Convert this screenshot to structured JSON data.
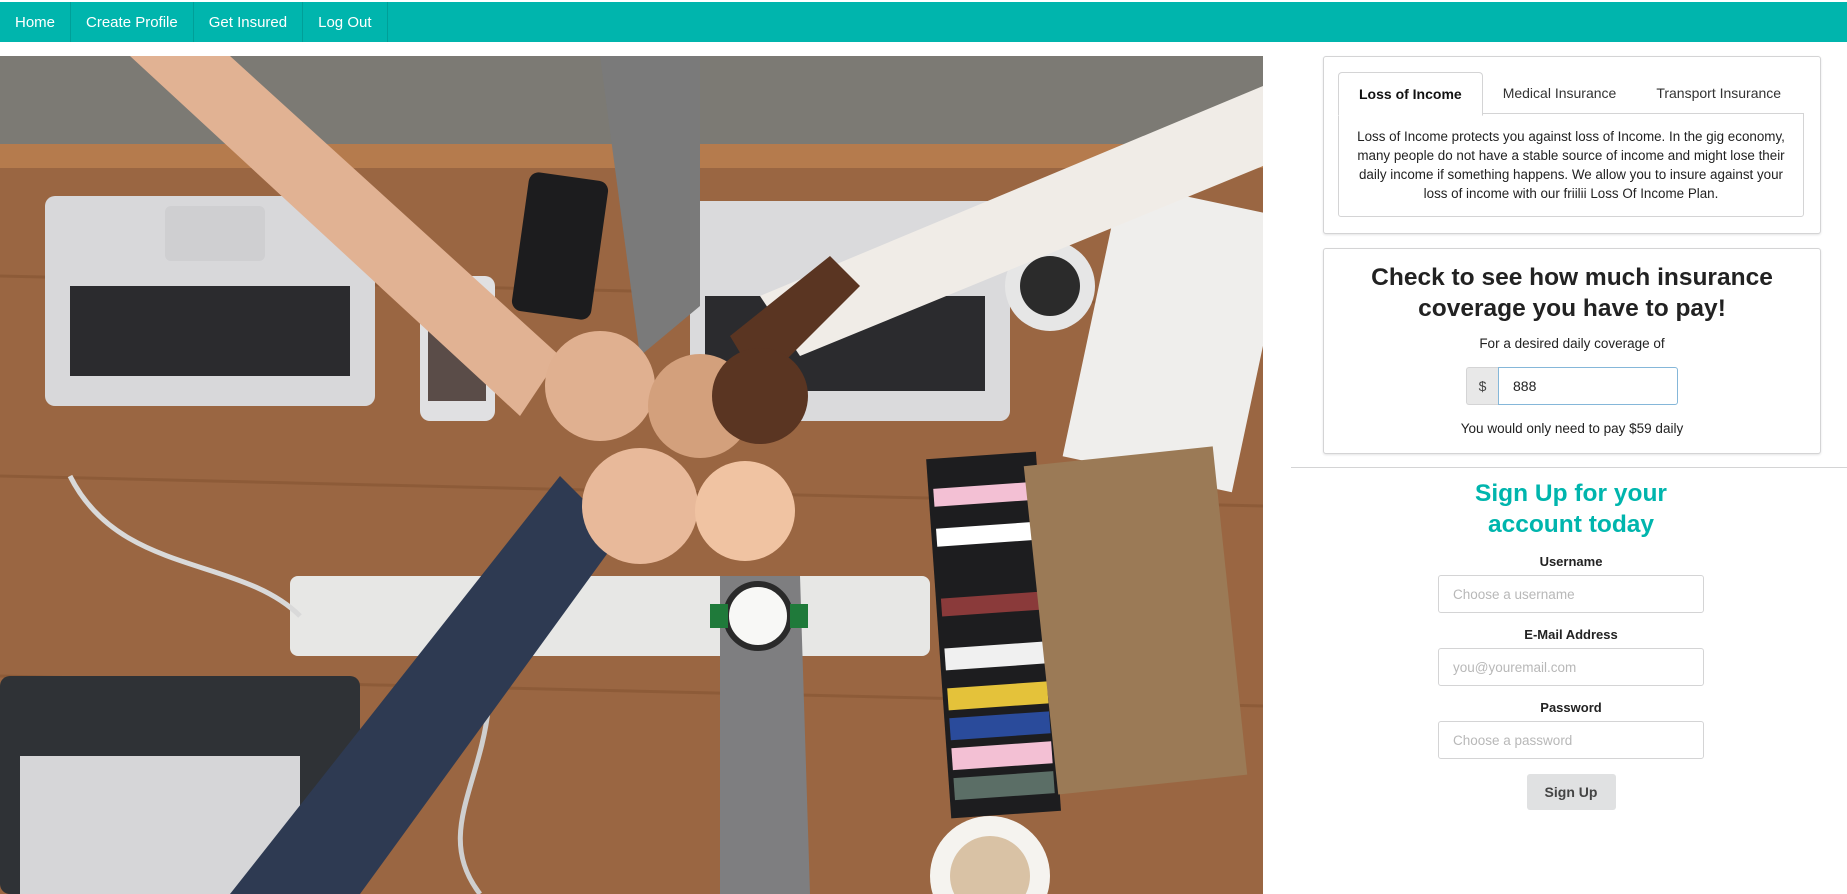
{
  "nav": {
    "items": [
      {
        "label": "Home"
      },
      {
        "label": "Create Profile"
      },
      {
        "label": "Get Insured"
      },
      {
        "label": "Log Out"
      }
    ]
  },
  "colors": {
    "accent": "#00b5ad",
    "navbar_text": "#ffffff"
  },
  "tabs": {
    "items": [
      {
        "label": "Loss of Income",
        "active": true
      },
      {
        "label": "Medical Insurance",
        "active": false
      },
      {
        "label": "Transport Insurance",
        "active": false
      }
    ],
    "content": "Loss of Income protects you against loss of Income. In the gig economy, many people do not have a stable source of income and might lose their daily income if something happens. We allow you to insure against your loss of income with our friilii Loss Of Income Plan."
  },
  "calculator": {
    "heading": "Check to see how much insurance coverage you have to pay!",
    "label": "For a desired daily coverage of",
    "currency_symbol": "$",
    "coverage_value": "888",
    "result": "You would only need to pay $59 daily"
  },
  "signup": {
    "title": "Sign Up for your account today",
    "username_label": "Username",
    "username_placeholder": "Choose a username",
    "email_label": "E-Mail Address",
    "email_placeholder": "you@youremail.com",
    "password_label": "Password",
    "password_placeholder": "Choose a password",
    "button_label": "Sign Up"
  }
}
